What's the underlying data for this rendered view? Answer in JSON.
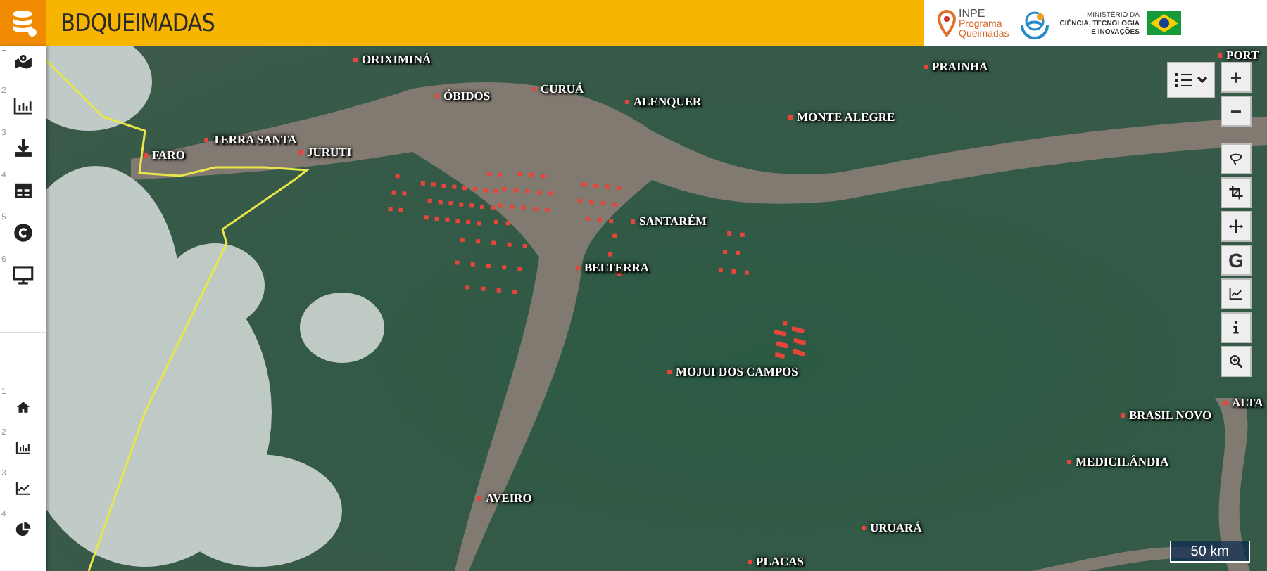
{
  "header": {
    "title": "BDQUEIMADAS",
    "program_logo": {
      "name": "INPE",
      "lines": [
        "Programa",
        "Queimadas"
      ]
    },
    "ministry_lines": [
      "MINISTÉRIO DA",
      "CIÊNCIA, TECNOLOGIA",
      "E INOVAÇÕES"
    ]
  },
  "sidebar": {
    "top_items": [
      {
        "number": "1",
        "kind": "map"
      },
      {
        "number": "2",
        "kind": "chart"
      },
      {
        "number": "3",
        "kind": "download"
      },
      {
        "number": "4",
        "kind": "table"
      },
      {
        "number": "5",
        "kind": "copyright"
      },
      {
        "number": "6",
        "kind": "monitor"
      }
    ],
    "bottom_items": [
      {
        "number": "1",
        "kind": "home"
      },
      {
        "number": "2",
        "kind": "chart"
      },
      {
        "number": "3",
        "kind": "line"
      },
      {
        "number": "4",
        "kind": "pie"
      }
    ]
  },
  "map": {
    "places": [
      {
        "name": "ORIXIMINÁ"
      },
      {
        "name": "ÓBIDOS"
      },
      {
        "name": "CURUÁ"
      },
      {
        "name": "ALENQUER"
      },
      {
        "name": "PRAINHA"
      },
      {
        "name": "PORT"
      },
      {
        "name": "MONTE ALEGRE"
      },
      {
        "name": "TERRA SANTA"
      },
      {
        "name": "FARO"
      },
      {
        "name": "JURUTI"
      },
      {
        "name": "SANTARÉM"
      },
      {
        "name": "BELTERRA"
      },
      {
        "name": "MOJUI DOS CAMPOS"
      },
      {
        "name": "ALTA"
      },
      {
        "name": "BRASIL NOVO"
      },
      {
        "name": "MEDICILÂNDIA"
      },
      {
        "name": "AVEIRO"
      },
      {
        "name": "URUARÁ"
      },
      {
        "name": "PLACAS"
      }
    ],
    "zoom_in": "+",
    "zoom_out": "−",
    "tools": [
      {
        "kind": "lasso"
      },
      {
        "kind": "crop"
      },
      {
        "kind": "move"
      },
      {
        "kind": "letter",
        "label": "G"
      },
      {
        "kind": "chart"
      },
      {
        "kind": "info"
      },
      {
        "kind": "zoom"
      }
    ],
    "scale": "50 km"
  }
}
